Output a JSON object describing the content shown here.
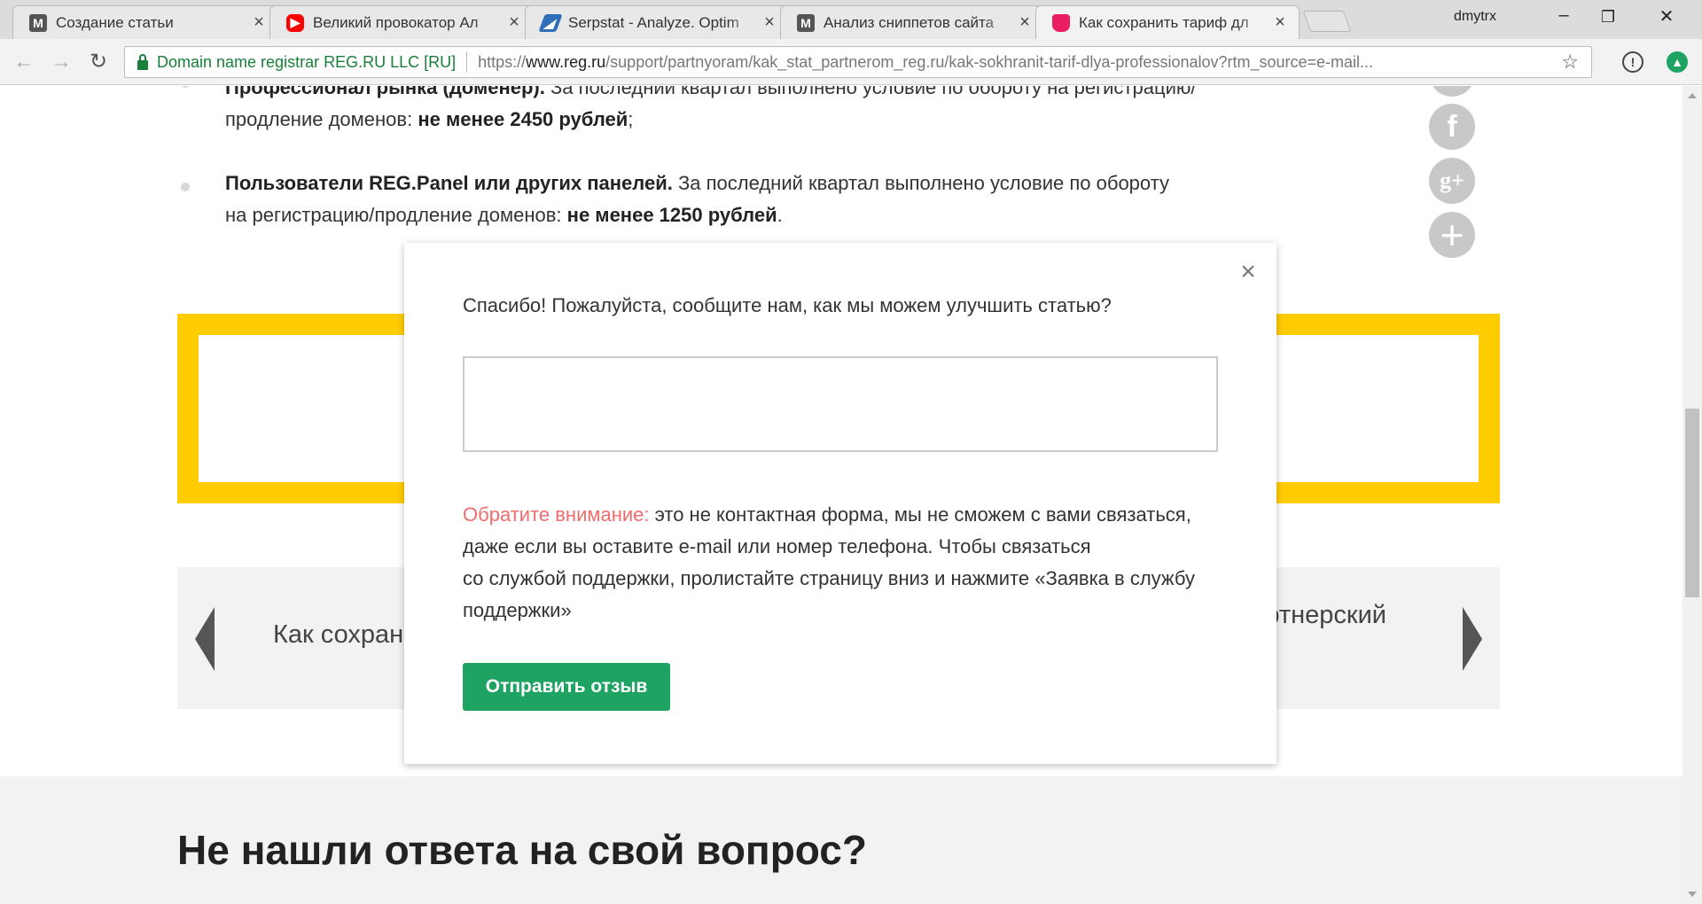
{
  "browser": {
    "tabs": [
      {
        "title": "Создание статьи",
        "icon": "m-logo-icon",
        "color": "#555555"
      },
      {
        "title": "Великий провокатор Ал",
        "icon": "youtube-icon",
        "color": "#ff0000"
      },
      {
        "title": "Serpstat - Analyze. Optim",
        "icon": "serpstat-icon",
        "color": "#2d6fb8"
      },
      {
        "title": "Анализ сниппетов сайта",
        "icon": "m-logo-icon",
        "color": "#555555"
      },
      {
        "title": "Как сохранить тариф дл",
        "icon": "regru-icon",
        "color": "#e91e63"
      }
    ],
    "user": "dmytrx",
    "address": {
      "ev_label": "Domain name registrar REG.RU LLC [RU]",
      "url_scheme": "https://",
      "url_host": "www.reg.ru",
      "url_path": "/support/partnyoram/kak_stat_partnerom_reg.ru/kak-sokhranit-tarif-dlya-professionalov?rtm_source=e-mail..."
    }
  },
  "article": {
    "item1_line1_bold": "Профессионал рынка (доменер).",
    "item1_line1_text": " За последний квартал выполнено условие по обороту на регистрацию/",
    "item1_line2_text": "продление доменов: ",
    "item1_line2_bold": "не менее 2450 рублей",
    "item1_line2_end": ";",
    "item2_line1_bold": "Пользователи REG.Panel или других панелей.",
    "item2_line1_text": " За последний квартал выполнено условие по обороту",
    "item2_line2_text": "на регистрацию/продление доменов: ",
    "item2_line2_bold": "не менее 1250 рублей",
    "item2_line2_end": "."
  },
  "social": [
    {
      "icon": "twitter-icon",
      "glyph": ""
    },
    {
      "icon": "facebook-icon",
      "glyph": "f"
    },
    {
      "icon": "google-plus-icon",
      "glyph": "g+"
    },
    {
      "icon": "plus-icon",
      "glyph": "+"
    }
  ],
  "article_nav": {
    "prev_label": "Как сохран",
    "next_label": "ртнерский"
  },
  "footer": {
    "heading": "Не нашли ответа на свой вопрос?"
  },
  "feedback_modal": {
    "question": "Спасибо! Пожалуйста, сообщите нам, как мы можем улучшить статью?",
    "textarea_value": "",
    "note_warn": "Обратите внимание:",
    "note_line1": " это не контактная форма, мы не сможем с вами связаться,",
    "note_line2": "даже если вы оставите e-mail или номер телефона. Чтобы связаться",
    "note_line3": "со службой поддержки, пролистайте страницу вниз и нажмите «Заявка в службу",
    "note_line4": "поддержки»",
    "submit_label": "Отправить отзыв",
    "close_glyph": "×"
  }
}
